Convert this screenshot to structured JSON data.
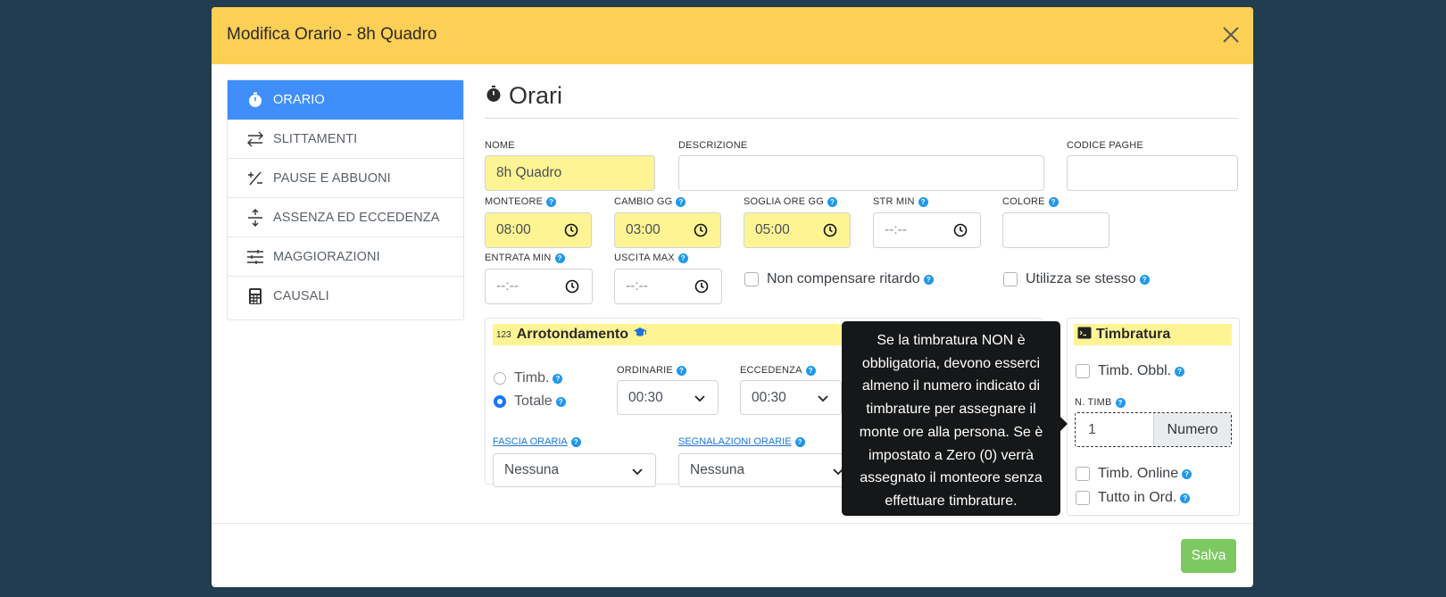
{
  "modal": {
    "title": "Modifica Orario - 8h Quadro"
  },
  "sidebar": {
    "items": [
      {
        "label": "ORARIO",
        "active": true
      },
      {
        "label": "SLITTAMENTI"
      },
      {
        "label": "PAUSE E ABBUONI"
      },
      {
        "label": "ASSENZA ED ECCEDENZA"
      },
      {
        "label": "MAGGIORAZIONI"
      },
      {
        "label": "CAUSALI"
      }
    ]
  },
  "section": {
    "title": "Orari"
  },
  "fields": {
    "nome": {
      "label": "NOME",
      "value": "8h Quadro"
    },
    "descrizione": {
      "label": "DESCRIZIONE",
      "value": ""
    },
    "codice_paghe": {
      "label": "CODICE PAGHE",
      "value": ""
    },
    "monteore": {
      "label": "MONTEORE",
      "value": "08:00"
    },
    "cambio_gg": {
      "label": "CAMBIO GG",
      "value": "03:00"
    },
    "soglia_ore_gg": {
      "label": "SOGLIA ORE GG",
      "value": "05:00"
    },
    "str_min": {
      "label": "STR MIN",
      "value": "--:--"
    },
    "colore": {
      "label": "COLORE",
      "value": ""
    },
    "entrata_min": {
      "label": "ENTRATA MIN",
      "value": "--:--"
    },
    "uscita_max": {
      "label": "USCITA MAX",
      "value": "--:--"
    },
    "non_compensare": {
      "label": "Non compensare ritardo"
    },
    "utilizza_se_stesso": {
      "label": "Utilizza se stesso"
    }
  },
  "arrotondamento": {
    "badge": "123",
    "title": "Arrotondamento",
    "timb_label": "Timb.",
    "totale_label": "Totale",
    "ordinarie": {
      "label": "ORDINARIE",
      "value": "00:30"
    },
    "eccedenza": {
      "label": "ECCEDENZA",
      "value": "00:30"
    },
    "fascia_oraria": {
      "label": "FASCIA ORARIA",
      "value": "Nessuna"
    },
    "segnalazioni_orarie": {
      "label": "SEGNALAZIONI ORARIE",
      "value": "Nessuna"
    }
  },
  "timbratura": {
    "title": "Timbratura",
    "timb_obbl": "Timb. Obbl.",
    "n_timb": {
      "label": "N. TIMB",
      "value": "1",
      "addon": "Numero"
    },
    "timb_online": "Timb. Online",
    "tutto_in_ord": "Tutto in Ord."
  },
  "tooltip": {
    "text": "Se la timbratura NON è obbligatoria, devono esserci almeno il numero indicato di timbrature per assegnare il monte ore alla persona. Se è impostato a Zero (0) verrà assegnato il monteore senza effettuare timbrature."
  },
  "footer": {
    "save_label": "Salva"
  },
  "colors": {
    "header": "#fccf55",
    "active": "#3f8ef9",
    "save": "#7dc961",
    "highlight": "#fef494"
  }
}
